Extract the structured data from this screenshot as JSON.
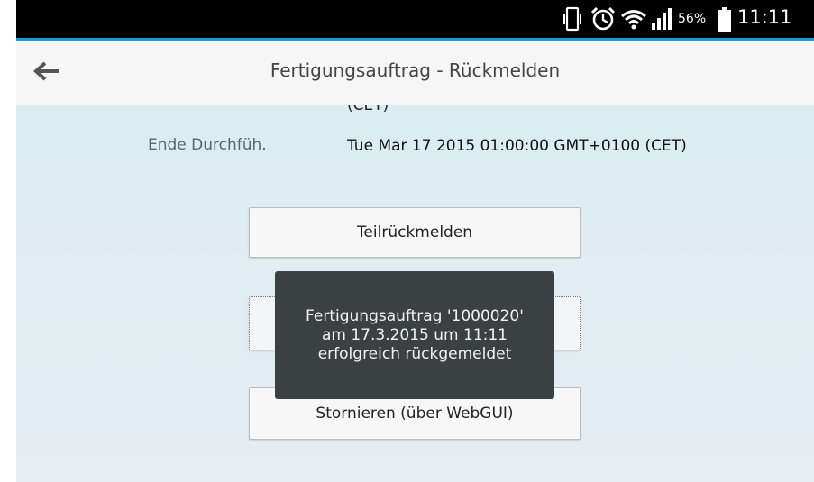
{
  "status_bar": {
    "battery_percent": "56%",
    "time": "11:11"
  },
  "header": {
    "title": "Fertigungsauftrag - Rückmelden"
  },
  "details": {
    "previous_value_tail": "(CET)",
    "end_label": "Ende Durchfüh.",
    "end_value": "Tue Mar 17 2015 01:00:00 GMT+0100 (CET)"
  },
  "buttons": {
    "partial_confirm": "Teilrückmelden",
    "cancel": "Stornieren (über WebGUI)"
  },
  "toast": {
    "message": "Fertigungsauftrag '1000020' am 17.3.2015 um 11:11 erfolgreich rückgemeldet"
  },
  "colors": {
    "accent": "#1a9fdb",
    "toast_bg": "#3b4143"
  }
}
